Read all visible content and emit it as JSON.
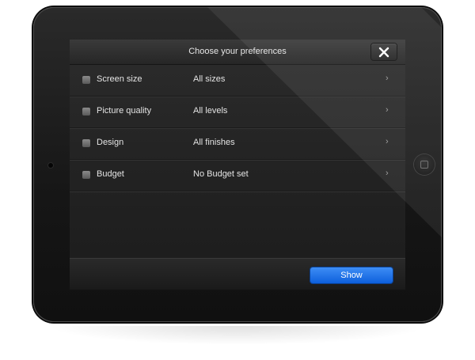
{
  "header": {
    "title": "Choose your preferences",
    "close_icon": "close-icon"
  },
  "preferences": [
    {
      "label": "Screen size",
      "value": "All sizes",
      "checked": false
    },
    {
      "label": "Picture quality",
      "value": "All levels",
      "checked": false
    },
    {
      "label": "Design",
      "value": "All finishes",
      "checked": false
    },
    {
      "label": "Budget",
      "value": "No Budget set",
      "checked": false
    }
  ],
  "chevron": "›",
  "footer": {
    "show_label": "Show"
  },
  "colors": {
    "accent": "#1a72ea",
    "screen_bg": "#232323",
    "device": "#161616"
  }
}
